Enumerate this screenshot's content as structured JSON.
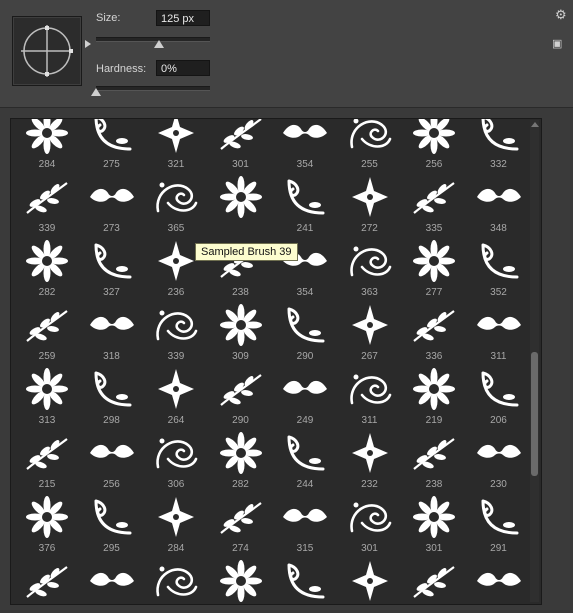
{
  "brush_settings": {
    "size_label": "Size:",
    "size_value": "125 px",
    "size_slider_fraction": 0.55,
    "hardness_label": "Hardness:",
    "hardness_value": "0%",
    "hardness_slider_fraction": 0.0
  },
  "top_icons": {
    "gear": "gear-icon",
    "new_preset": "new-preset-icon"
  },
  "tooltip": "Sampled Brush 39",
  "brush_rows": [
    [
      "284",
      "275",
      "321",
      "301",
      "354",
      "255",
      "256",
      "332"
    ],
    [
      "339",
      "273",
      "365",
      "",
      "241",
      "272",
      "335",
      "348"
    ],
    [
      "282",
      "327",
      "236",
      "238",
      "354",
      "363",
      "277",
      "352"
    ],
    [
      "259",
      "318",
      "339",
      "309",
      "290",
      "267",
      "336",
      "311"
    ],
    [
      "313",
      "298",
      "264",
      "290",
      "249",
      "311",
      "219",
      "206"
    ],
    [
      "215",
      "256",
      "306",
      "282",
      "244",
      "232",
      "238",
      "230"
    ],
    [
      "376",
      "295",
      "284",
      "274",
      "315",
      "301",
      "301",
      "291"
    ],
    [
      "",
      "",
      "",
      "",
      "",
      "",
      "",
      ""
    ]
  ],
  "colors": {
    "panel_bg": "#2a2a2a",
    "brush_fill": "#ffffff",
    "tooltip_bg": "#fdfdcf"
  }
}
